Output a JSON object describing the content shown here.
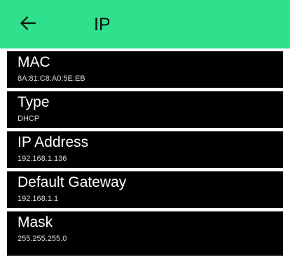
{
  "app_bar": {
    "title": "IP",
    "back_icon": "arrow-left-icon",
    "color": "#2fe08c"
  },
  "rows": [
    {
      "label": "MAC",
      "value": "8A:81:C8:A0:5E:EB"
    },
    {
      "label": "Type",
      "value": "DHCP"
    },
    {
      "label": "IP Address",
      "value": "192.168.1.136"
    },
    {
      "label": "Default Gateway",
      "value": "192.168.1.1"
    },
    {
      "label": "Mask",
      "value": "255.255.255.0"
    }
  ]
}
